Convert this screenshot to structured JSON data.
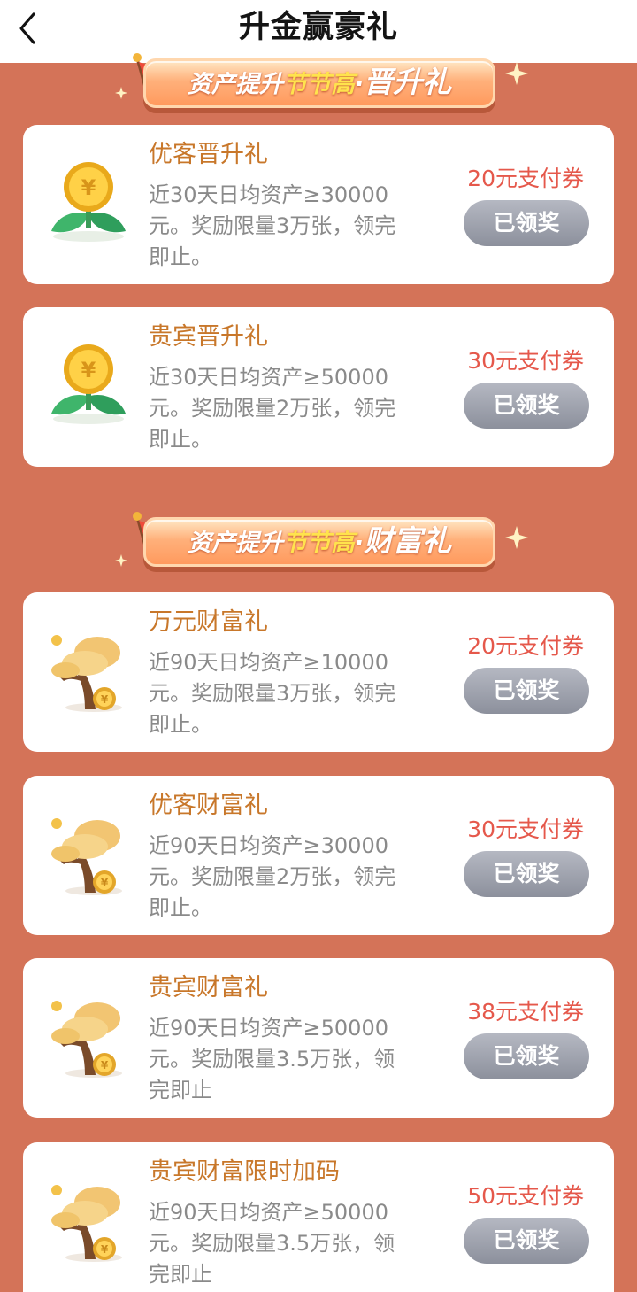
{
  "header": {
    "title": "升金赢豪礼",
    "back_icon": "chevron-left-icon"
  },
  "sections": [
    {
      "banner": {
        "prefix": "资产提升",
        "highlight": "节节高",
        "dot": "·",
        "name": "晋升礼"
      },
      "items": [
        {
          "title": "优客晋升礼",
          "desc": "近30天日均资产≥30000元。奖励限量3万张，领完即止。",
          "coupon": "20元支付券",
          "button": "已领奖",
          "icon": "coin-flower-icon"
        },
        {
          "title": "贵宾晋升礼",
          "desc": "近30天日均资产≥50000元。奖励限量2万张，领完即止。",
          "coupon": "30元支付券",
          "button": "已领奖",
          "icon": "coin-flower-icon"
        }
      ]
    },
    {
      "banner": {
        "prefix": "资产提升",
        "highlight": "节节高",
        "dot": "·",
        "name": "财富礼"
      },
      "items": [
        {
          "title": "万元财富礼",
          "desc": "近90天日均资产≥10000元。奖励限量3万张，领完即止。",
          "coupon": "20元支付券",
          "button": "已领奖",
          "icon": "money-tree-icon"
        },
        {
          "title": "优客财富礼",
          "desc": "近90天日均资产≥30000元。奖励限量2万张，领完即止。",
          "coupon": "30元支付券",
          "button": "已领奖",
          "icon": "money-tree-icon"
        },
        {
          "title": "贵宾财富礼",
          "desc": "近90天日均资产≥50000元。奖励限量3.5万张，领完即止",
          "coupon": "38元支付券",
          "button": "已领奖",
          "icon": "money-tree-icon"
        },
        {
          "title": "贵宾财富限时加码",
          "desc": "近90天日均资产≥50000元。奖励限量3.5万张，领完即止",
          "coupon": "50元支付券",
          "button": "已领奖",
          "icon": "money-tree-icon"
        }
      ]
    }
  ],
  "colors": {
    "page_bg": "#d47358",
    "title": "#c8772a",
    "coupon": "#e5584b",
    "button": "#9a9da8"
  }
}
